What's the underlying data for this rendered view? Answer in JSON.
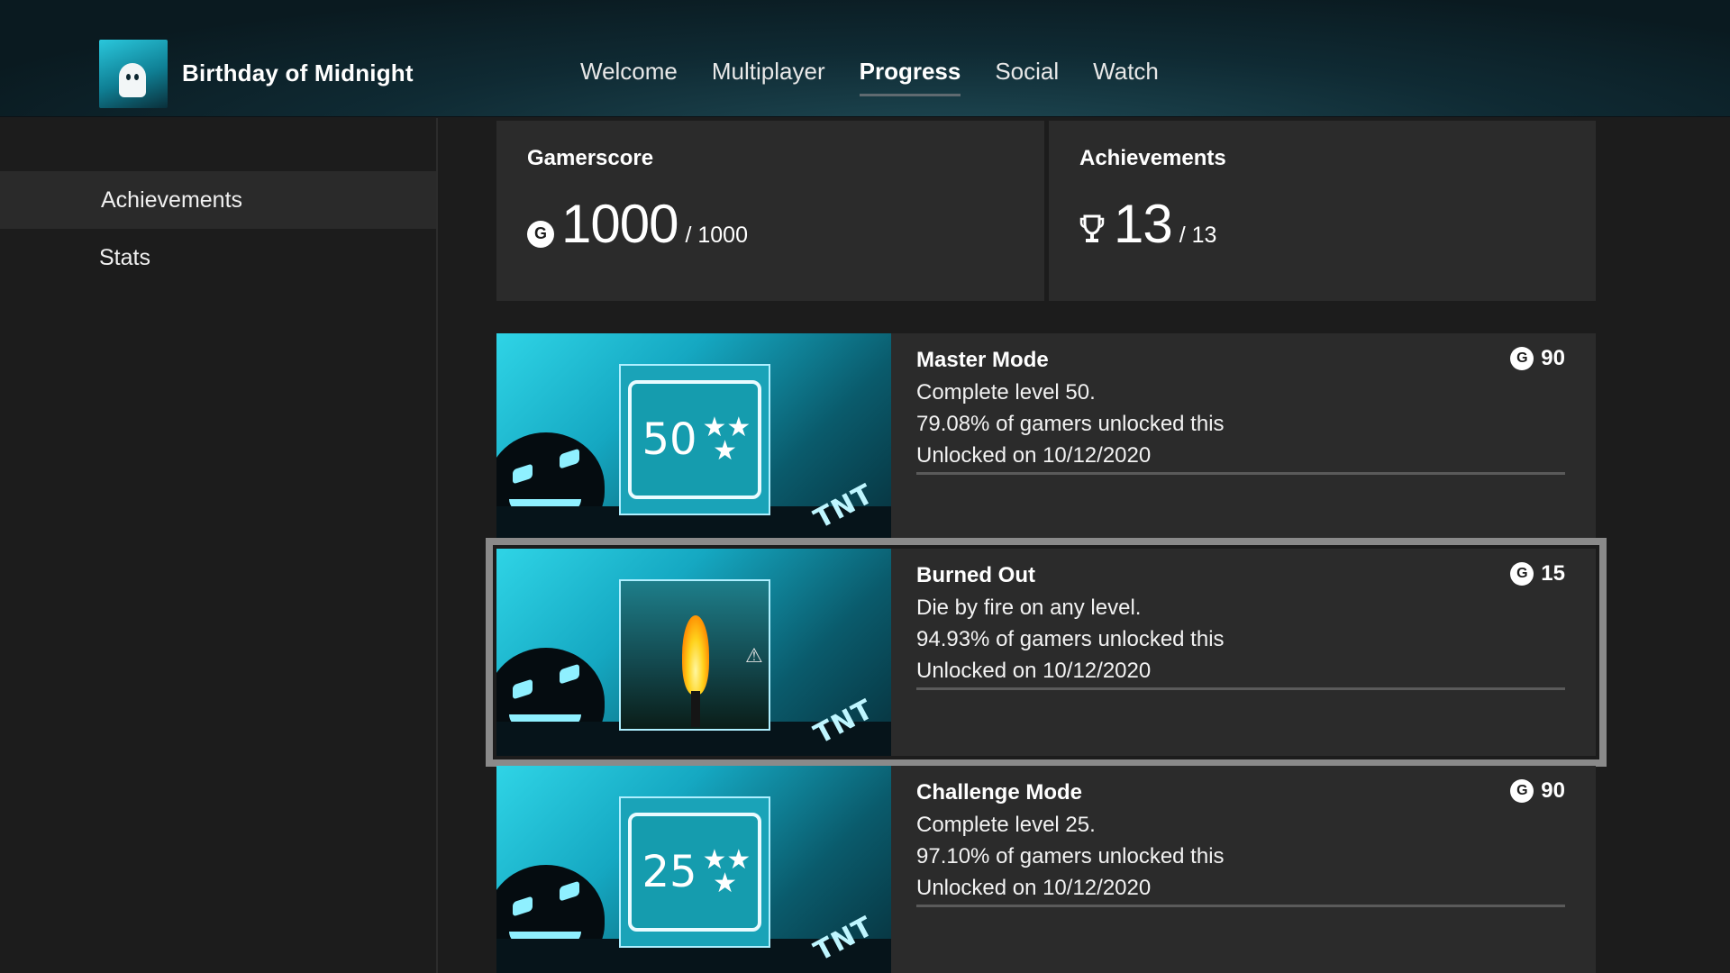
{
  "game": {
    "title": "Birthday of Midnight"
  },
  "nav": {
    "tabs": [
      {
        "label": "Welcome",
        "active": false
      },
      {
        "label": "Multiplayer",
        "active": false
      },
      {
        "label": "Progress",
        "active": true
      },
      {
        "label": "Social",
        "active": false
      },
      {
        "label": "Watch",
        "active": false
      }
    ]
  },
  "sidebar": {
    "items": [
      {
        "label": "Achievements",
        "selected": true
      },
      {
        "label": "Stats",
        "selected": false
      }
    ]
  },
  "summary": {
    "gamerscore": {
      "label": "Gamerscore",
      "icon": "gamerscore-icon",
      "value": "1000",
      "total": "/ 1000"
    },
    "achievements": {
      "label": "Achievements",
      "icon": "trophy-icon",
      "value": "13",
      "total": "/ 13"
    }
  },
  "achievements": [
    {
      "title": "Master Mode",
      "description": "Complete level 50.",
      "percent": "79.08% of gamers unlocked this",
      "unlocked": "Unlocked on 10/12/2020",
      "gamerscore": "90",
      "art": "level-50-badge",
      "focused": false
    },
    {
      "title": "Burned Out",
      "description": "Die by fire on any level.",
      "percent": "94.93% of gamers unlocked this",
      "unlocked": "Unlocked on 10/12/2020",
      "gamerscore": "15",
      "art": "fire-scene",
      "focused": true
    },
    {
      "title": "Challenge Mode",
      "description": "Complete level 25.",
      "percent": "97.10% of gamers unlocked this",
      "unlocked": "Unlocked on 10/12/2020",
      "gamerscore": "90",
      "art": "level-25-badge",
      "focused": false
    }
  ],
  "art_labels": {
    "level_50": "50",
    "level_25": "25",
    "tnt": "TNT",
    "g_badge": "G"
  },
  "colors": {
    "background": "#1c1c1c",
    "tile": "#2b2b2b",
    "focus_outline": "#8a8a8a",
    "accent_cyan": "#2fd4e6"
  }
}
